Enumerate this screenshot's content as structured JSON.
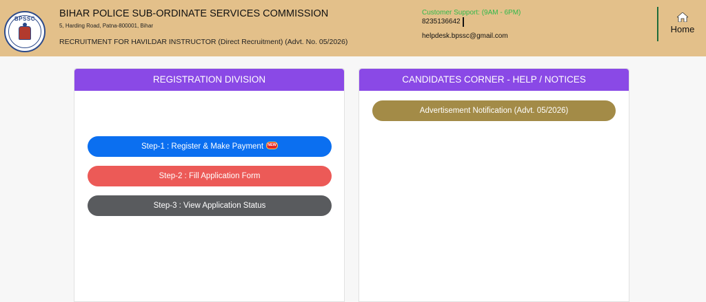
{
  "header": {
    "logo_text": "BPSSC",
    "title": "BIHAR POLICE SUB-ORDINATE SERVICES COMMISSION",
    "address": "5, Harding Road, Patna-800001, Bihar",
    "recruitment": "RECRUITMENT FOR HAVILDAR INSTRUCTOR (Direct Recruitment) (Advt. No. 05/2026)",
    "support_label": "Customer Support: (9AM - 6PM)",
    "phone": "8235136642",
    "email": "helpdesk.bpssc@gmail.com",
    "home_label": "Home",
    "home_icon": "home-icon"
  },
  "registration": {
    "heading": "REGISTRATION DIVISION",
    "step1": "Step-1 : Register & Make Payment",
    "new_badge": "NEW",
    "step2": "Step-2 : Fill Application Form",
    "step3": "Step-3 : View Application Status"
  },
  "notices": {
    "heading": "CANDIDATES CORNER - HELP / NOTICES",
    "advertisement": "Advertisement Notification (Advt. 05/2026)"
  },
  "colors": {
    "header_bg": "#e3c08a",
    "panel_head": "#8a49e6",
    "step1": "#0b6ff0",
    "step2": "#ec5a57",
    "step3": "#595b5e",
    "advertisement": "#a38b47",
    "support_green": "#2fb84a"
  }
}
